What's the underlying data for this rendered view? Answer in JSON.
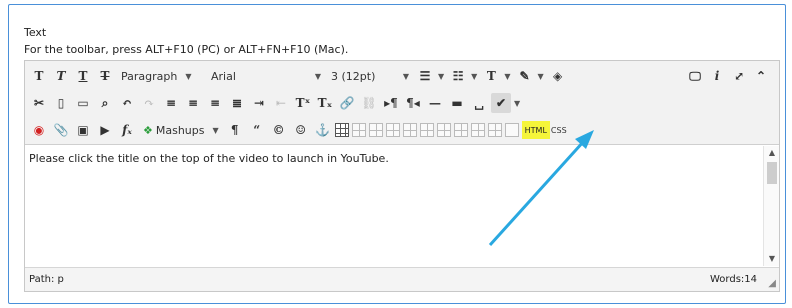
{
  "field": {
    "label": "Text",
    "help": "For the toolbar, press ALT+F10 (PC) or ALT+FN+F10 (Mac)."
  },
  "toolbar": {
    "paragraph": "Paragraph",
    "font": "Arial",
    "size": "3 (12pt)",
    "mashups": "Mashups",
    "html_label": "HTML",
    "css_label": "CSS",
    "glyphs": {
      "bold": "T",
      "italic": "T",
      "underline": "T",
      "strike": "T",
      "italic_i": "i",
      "superscript": "Tˣ",
      "subscript": "Tₓ",
      "pilcrow": "¶",
      "quote": "“",
      "copyright": "©",
      "smiley": "☺",
      "anchor": "⚓",
      "fx": "f",
      "expand": "⤢",
      "collapse": "⌃"
    }
  },
  "editor": {
    "body_text": "Please click the title on the top of the video to launch in YouTube."
  },
  "status": {
    "path": "Path: p",
    "words": "Words:14"
  },
  "colors": {
    "frame_border": "#4a90d9",
    "html_highlight": "#f5f53a",
    "arrow": "#29a8e0"
  }
}
